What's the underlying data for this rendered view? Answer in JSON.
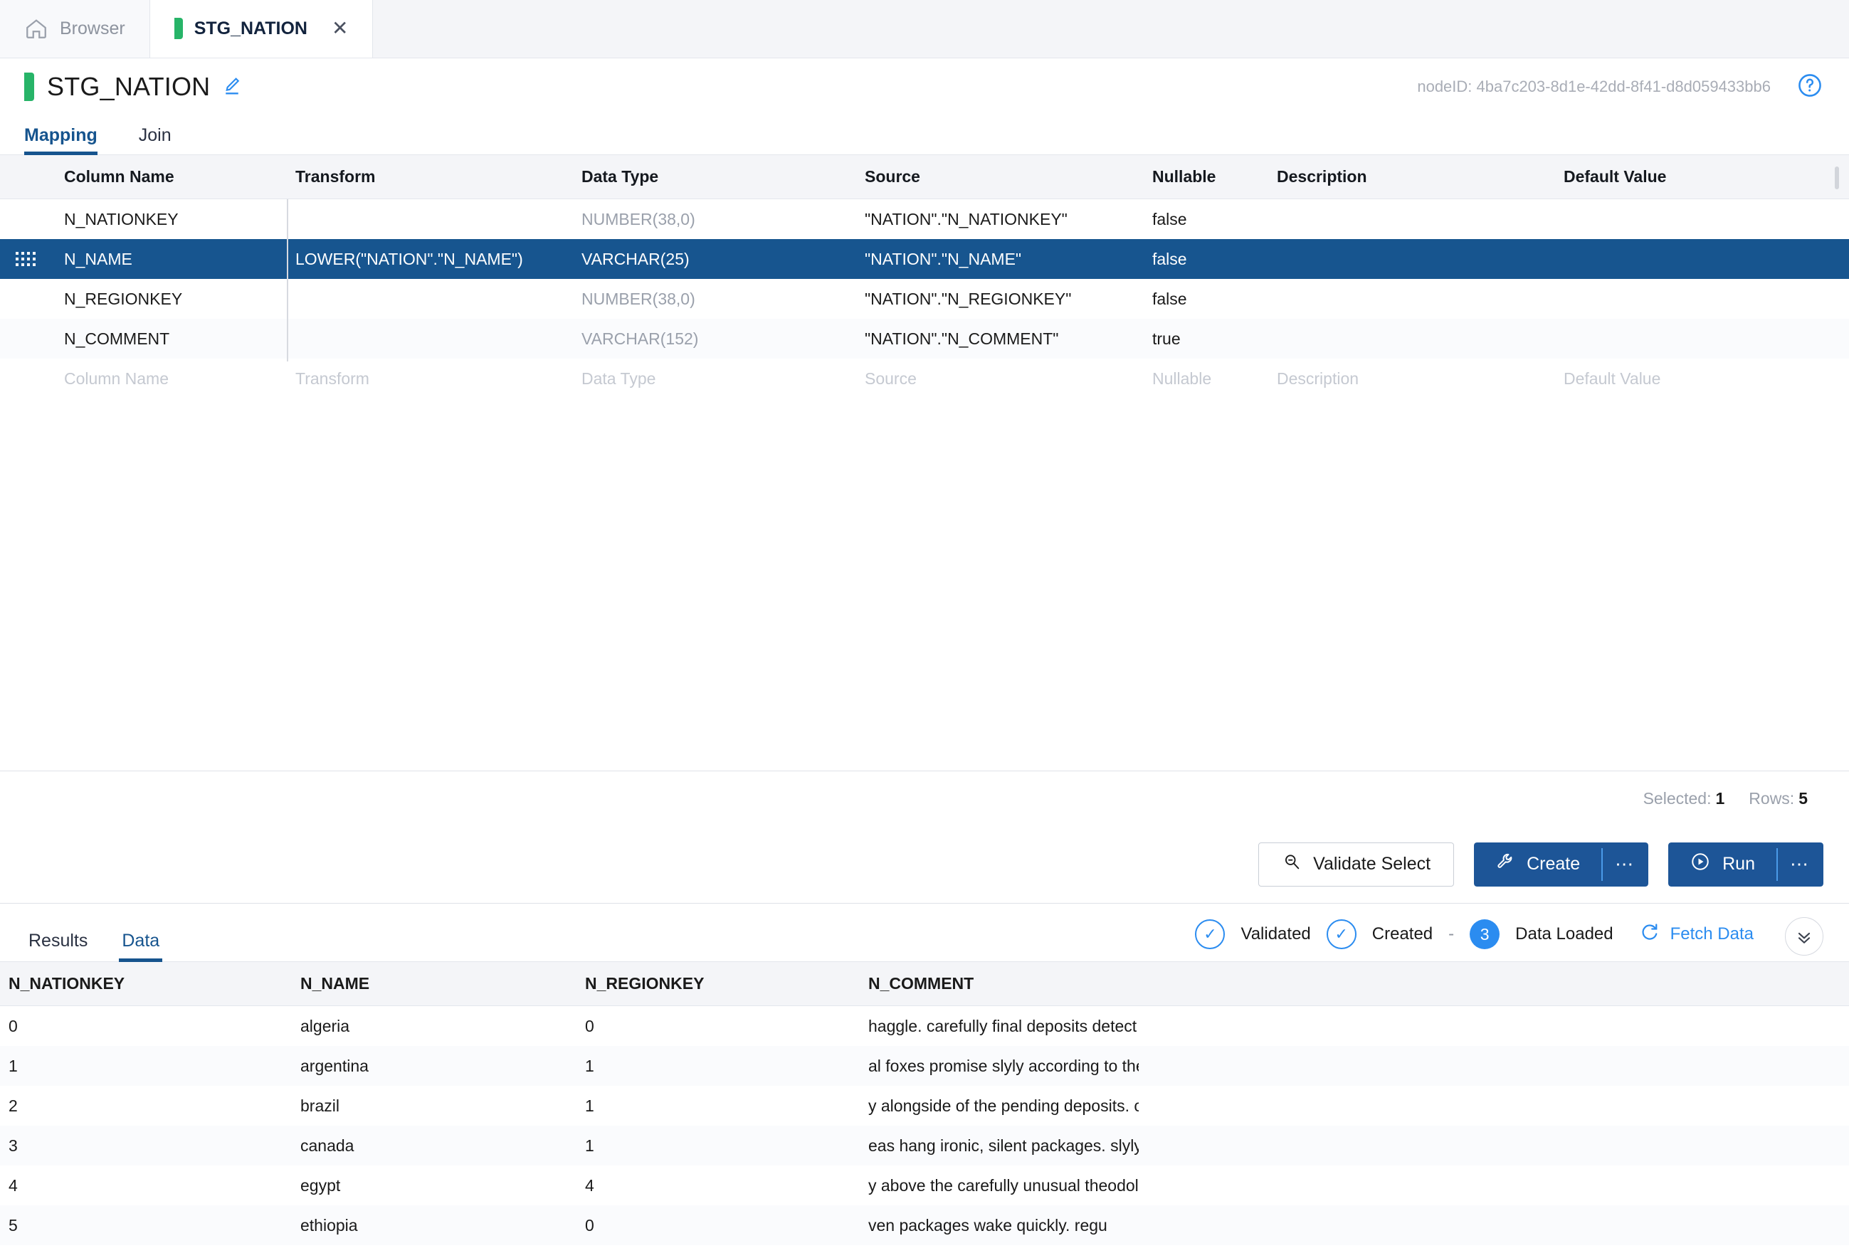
{
  "tabstrip": {
    "tabs": [
      {
        "label": "Browser",
        "icon": "home-icon",
        "active": false
      },
      {
        "label": "STG_NATION",
        "icon": "green-node-marker",
        "active": true,
        "close": "✕"
      }
    ]
  },
  "header": {
    "title": "STG_NATION",
    "edit_icon": "pencil-icon",
    "node_id": "nodeID: 4ba7c203-8d1e-42dd-8f41-d8d059433bb6",
    "help_icon": "help-circle-icon"
  },
  "subtabs": [
    {
      "label": "Mapping",
      "active": true
    },
    {
      "label": "Join",
      "active": false
    }
  ],
  "mapping": {
    "columns": [
      "Column Name",
      "Transform",
      "Data Type",
      "Source",
      "Nullable",
      "Description",
      "Default Value"
    ],
    "rows": [
      {
        "column_name": "N_NATIONKEY",
        "transform": "",
        "data_type": "NUMBER(38,0)",
        "source": "\"NATION\".\"N_NATIONKEY\"",
        "nullable": "false",
        "description": "",
        "default_value": "",
        "selected": false
      },
      {
        "column_name": "N_NAME",
        "transform": "LOWER(\"NATION\".\"N_NAME\")",
        "data_type": "VARCHAR(25)",
        "source": "\"NATION\".\"N_NAME\"",
        "nullable": "false",
        "description": "",
        "default_value": "",
        "selected": true
      },
      {
        "column_name": "N_REGIONKEY",
        "transform": "",
        "data_type": "NUMBER(38,0)",
        "source": "\"NATION\".\"N_REGIONKEY\"",
        "nullable": "false",
        "description": "",
        "default_value": "",
        "selected": false
      },
      {
        "column_name": "N_COMMENT",
        "transform": "",
        "data_type": "VARCHAR(152)",
        "source": "\"NATION\".\"N_COMMENT\"",
        "nullable": "true",
        "description": "",
        "default_value": "",
        "selected": false
      }
    ],
    "placeholder_row": {
      "column_name": "Column Name",
      "transform": "Transform",
      "data_type": "Data Type",
      "source": "Source",
      "nullable": "Nullable",
      "description": "Description",
      "default_value": "Default Value"
    }
  },
  "status": {
    "selected_label": "Selected:",
    "selected_value": "1",
    "rows_label": "Rows:",
    "rows_value": "5"
  },
  "actions": {
    "validate_select": "Validate Select",
    "validate_icon": "magnifier-icon",
    "create": "Create",
    "create_icon": "wrench-icon",
    "create_more": "⋯",
    "run": "Run",
    "run_icon": "play-circle-icon",
    "run_more": "⋯"
  },
  "results": {
    "tabs": [
      {
        "label": "Results",
        "active": false
      },
      {
        "label": "Data",
        "active": true
      }
    ],
    "pipeline": {
      "validated": "Validated",
      "created": "Created",
      "separator": "-",
      "loaded_count": "3",
      "data_loaded": "Data Loaded",
      "fetch_data": "Fetch Data",
      "fetch_icon": "refresh-icon",
      "collapse_icon": "chevron-double-down-icon"
    }
  },
  "data_grid": {
    "columns": [
      "N_NATIONKEY",
      "N_NAME",
      "N_REGIONKEY",
      "N_COMMENT"
    ],
    "rows": [
      [
        "0",
        "algeria",
        "0",
        "haggle. carefully final deposits detect slyly …"
      ],
      [
        "1",
        "argentina",
        "1",
        "al foxes promise slyly according to the reg…"
      ],
      [
        "2",
        "brazil",
        "1",
        "y alongside of the pending deposits. carefu…"
      ],
      [
        "3",
        "canada",
        "1",
        "eas hang ironic, silent packages. slyly regul…"
      ],
      [
        "4",
        "egypt",
        "4",
        "y above the carefully unusual theodolites. fi…"
      ],
      [
        "5",
        "ethiopia",
        "0",
        "ven packages wake quickly. regu"
      ]
    ]
  },
  "colors": {
    "accent_blue": "#1d5597",
    "selected_row": "#17558f",
    "link_blue": "#2b8cf0",
    "green_marker": "#27b468",
    "header_bg": "#f4f5f8"
  }
}
